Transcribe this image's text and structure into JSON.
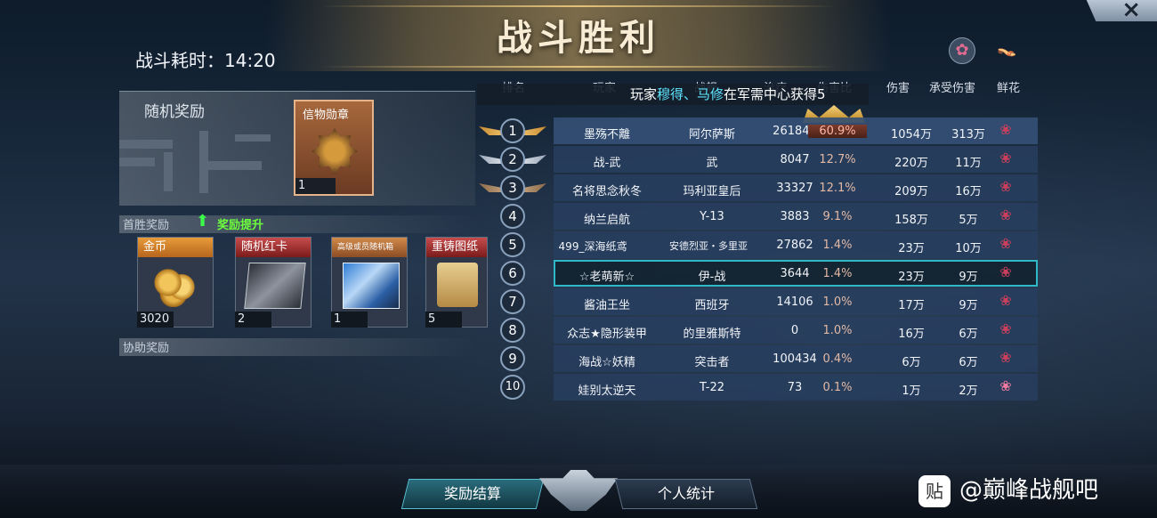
{
  "header": {
    "title": "战斗胜利",
    "battle_time_label": "战斗耗时：",
    "battle_time": "14:20",
    "close_icon": "×"
  },
  "rewards": {
    "random_label": "随机奖励",
    "medal": {
      "title": "信物勋章",
      "count": "1"
    },
    "first_win_label": "首胜奖励",
    "boost_label": "奖励提升",
    "items": [
      {
        "title": "金币",
        "count": "3020",
        "icon": "coins-icon"
      },
      {
        "title": "随机红卡",
        "count": "2",
        "icon": "card-icon"
      },
      {
        "title": "高级或员随机箱",
        "count": "1",
        "icon": "box-icon"
      },
      {
        "title": "重铸图纸",
        "count": "5",
        "icon": "blueprint-icon"
      }
    ],
    "assist_label": "协助奖励"
  },
  "table": {
    "headers": [
      "排名",
      "玩家",
      "战舰",
      "治疗",
      "伤害比",
      "伤害",
      "承受伤害",
      "鲜花"
    ],
    "notice": {
      "prefix": "玩家",
      "names": "穆得、马修",
      "suffix": "在军需中心获得5"
    },
    "rows": [
      {
        "rank": "1",
        "player": "墨殇不離",
        "ship": "阿尔萨斯",
        "heal": "261841",
        "ratio": "60.9%",
        "damage": "1054万",
        "taken": "313万"
      },
      {
        "rank": "2",
        "player": "战-武",
        "ship": "武",
        "heal": "8047",
        "ratio": "12.7%",
        "damage": "220万",
        "taken": "11万"
      },
      {
        "rank": "3",
        "player": "名将思念秋冬",
        "ship": "玛利亚皇后",
        "heal": "33327",
        "ratio": "12.1%",
        "damage": "209万",
        "taken": "16万"
      },
      {
        "rank": "4",
        "player": "纳兰启航",
        "ship": "Y-13",
        "heal": "3883",
        "ratio": "9.1%",
        "damage": "158万",
        "taken": "5万"
      },
      {
        "rank": "5",
        "player": "499_深海纸鸢",
        "ship": "安德烈亚・多里亚",
        "heal": "27862",
        "ratio": "1.4%",
        "damage": "23万",
        "taken": "10万"
      },
      {
        "rank": "6",
        "player": "☆老萌新☆",
        "ship": "伊-战",
        "heal": "3644",
        "ratio": "1.4%",
        "damage": "23万",
        "taken": "9万"
      },
      {
        "rank": "7",
        "player": "酱油王坐",
        "ship": "西班牙",
        "heal": "14106",
        "ratio": "1.0%",
        "damage": "17万",
        "taken": "9万"
      },
      {
        "rank": "8",
        "player": "众志★隐形装甲",
        "ship": "的里雅斯特",
        "heal": "0",
        "ratio": "1.0%",
        "damage": "16万",
        "taken": "6万"
      },
      {
        "rank": "9",
        "player": "海战☆妖精",
        "ship": "突击者",
        "heal": "100434",
        "ratio": "0.4%",
        "damage": "6万",
        "taken": "6万"
      },
      {
        "rank": "10",
        "player": "娃别太逆天",
        "ship": "T-22",
        "heal": "73",
        "ratio": "0.1%",
        "damage": "1万",
        "taken": "2万"
      }
    ]
  },
  "bottom": {
    "reward_tab": "奖励结算",
    "stats_tab": "个人统计",
    "watermark": "@巅峰战舰吧",
    "watermark_logo": "贴"
  }
}
